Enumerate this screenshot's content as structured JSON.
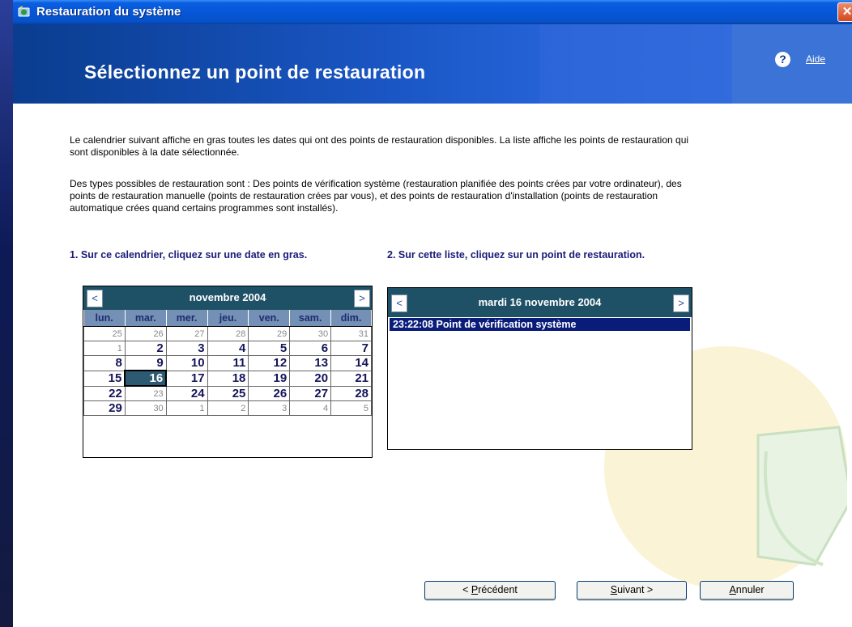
{
  "window": {
    "title": "Restauration du système"
  },
  "banner": {
    "title": "Sélectionnez un point de restauration",
    "help_label": "Aide"
  },
  "content": {
    "paragraph1": "Le calendrier suivant affiche en gras toutes les dates qui ont des points de restauration disponibles. La liste affiche les points de restauration qui sont disponibles à la date sélectionnée.",
    "paragraph2": "Des types possibles de restauration sont : Des points de vérification système (restauration planifiée des points crées par votre ordinateur), des points de restauration manuelle (points de restauration crées par vous), et des points de restauration d'installation (points de restauration automatique crées quand certains programmes sont installés).",
    "step1_label": "1. Sur ce calendrier, cliquez sur une date en gras.",
    "step2_label": "2. Sur cette liste, cliquez sur un point de restauration."
  },
  "calendar": {
    "prev_label": "<",
    "next_label": ">",
    "month_title": "novembre 2004",
    "weekdays": [
      "lun.",
      "mar.",
      "mer.",
      "jeu.",
      "ven.",
      "sam.",
      "dim."
    ],
    "weeks": [
      [
        {
          "d": "25",
          "s": "other"
        },
        {
          "d": "26",
          "s": "other"
        },
        {
          "d": "27",
          "s": "other"
        },
        {
          "d": "28",
          "s": "other"
        },
        {
          "d": "29",
          "s": "other"
        },
        {
          "d": "30",
          "s": "other"
        },
        {
          "d": "31",
          "s": "other"
        }
      ],
      [
        {
          "d": "1",
          "s": "plain"
        },
        {
          "d": "2",
          "s": "avail"
        },
        {
          "d": "3",
          "s": "avail"
        },
        {
          "d": "4",
          "s": "avail"
        },
        {
          "d": "5",
          "s": "avail"
        },
        {
          "d": "6",
          "s": "avail"
        },
        {
          "d": "7",
          "s": "avail"
        }
      ],
      [
        {
          "d": "8",
          "s": "avail"
        },
        {
          "d": "9",
          "s": "avail"
        },
        {
          "d": "10",
          "s": "avail"
        },
        {
          "d": "11",
          "s": "avail"
        },
        {
          "d": "12",
          "s": "avail"
        },
        {
          "d": "13",
          "s": "avail"
        },
        {
          "d": "14",
          "s": "avail"
        }
      ],
      [
        {
          "d": "15",
          "s": "avail"
        },
        {
          "d": "16",
          "s": "selected"
        },
        {
          "d": "17",
          "s": "avail"
        },
        {
          "d": "18",
          "s": "avail"
        },
        {
          "d": "19",
          "s": "avail"
        },
        {
          "d": "20",
          "s": "avail"
        },
        {
          "d": "21",
          "s": "avail"
        }
      ],
      [
        {
          "d": "22",
          "s": "avail"
        },
        {
          "d": "23",
          "s": "plain"
        },
        {
          "d": "24",
          "s": "avail"
        },
        {
          "d": "25",
          "s": "avail"
        },
        {
          "d": "26",
          "s": "avail"
        },
        {
          "d": "27",
          "s": "avail"
        },
        {
          "d": "28",
          "s": "avail"
        }
      ],
      [
        {
          "d": "29",
          "s": "avail"
        },
        {
          "d": "30",
          "s": "plain"
        },
        {
          "d": "1",
          "s": "other"
        },
        {
          "d": "2",
          "s": "other"
        },
        {
          "d": "3",
          "s": "other"
        },
        {
          "d": "4",
          "s": "other"
        },
        {
          "d": "5",
          "s": "other"
        }
      ]
    ]
  },
  "restore_list": {
    "prev_label": "<",
    "next_label": ">",
    "date_title": "mardi 16 novembre 2004",
    "items": [
      "23:22:08  Point de vérification système"
    ]
  },
  "buttons": {
    "previous": {
      "prefix": "< ",
      "accel": "P",
      "rest": "récédent"
    },
    "next": {
      "prefix": "",
      "accel": "S",
      "rest": "uivant >"
    },
    "cancel": {
      "prefix": "",
      "accel": "A",
      "rest": "nnuler"
    }
  },
  "colors": {
    "title_bar": "#0656d8",
    "header_teal": "#1f5166",
    "selected_row": "#0a1c7a",
    "weekday_bg": "#7490b5"
  }
}
